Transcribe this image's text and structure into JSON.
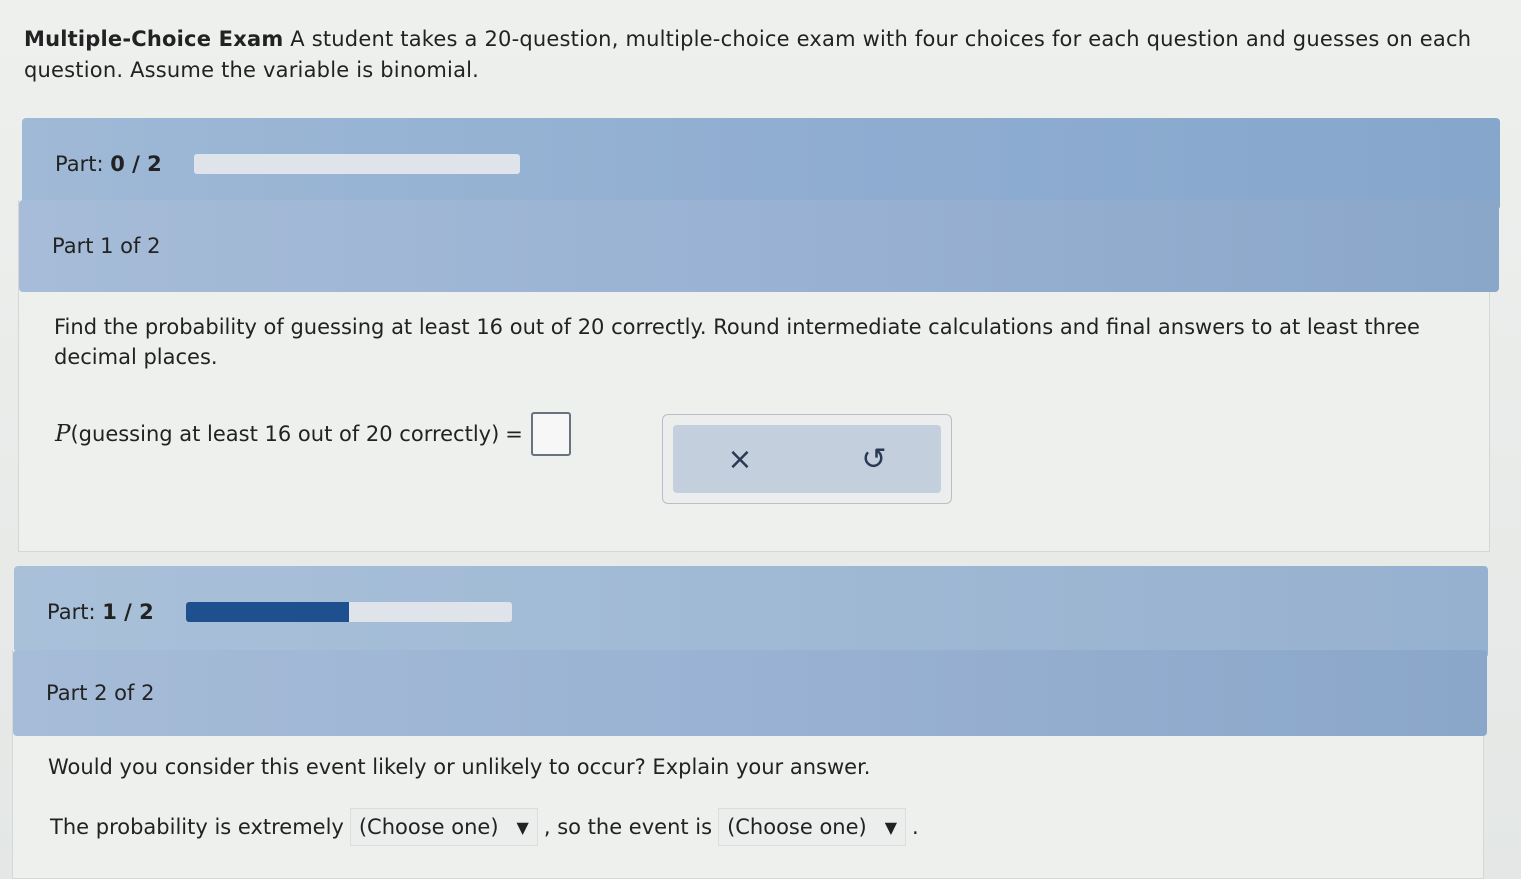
{
  "intro": {
    "title": "Multiple-Choice Exam",
    "text": " A student takes a 20-question, multiple-choice exam with four choices for each question and guesses on each question. Assume the variable is binomial."
  },
  "part_progress_1": {
    "label": "Part:",
    "value": "0 / 2",
    "fraction": 0.0
  },
  "part1": {
    "header": "Part 1 of 2",
    "question": "Find the probability of guessing at least 16 out of 20 correctly. Round intermediate calculations and final answers to at least three decimal places.",
    "answer_P": "P",
    "answer_label": "(guessing at least 16 out of 20 correctly)",
    "equals": "=",
    "clear_icon": "×",
    "undo_icon": "↺"
  },
  "part_progress_2": {
    "label": "Part:",
    "value": "1 / 2",
    "fraction": 0.5
  },
  "part2": {
    "header": "Part 2 of 2",
    "question": "Would you consider this event likely or unlikely to occur? Explain your answer.",
    "sentence_start": "The probability is extremely",
    "select1": "(Choose one)",
    "sentence_mid": ", so the event is",
    "select2": "(Choose one)",
    "sentence_end": ".",
    "arrow": "▼"
  },
  "colors": {
    "progress_fill": "#1e4f8f",
    "header_blue": "#8fadd1"
  }
}
